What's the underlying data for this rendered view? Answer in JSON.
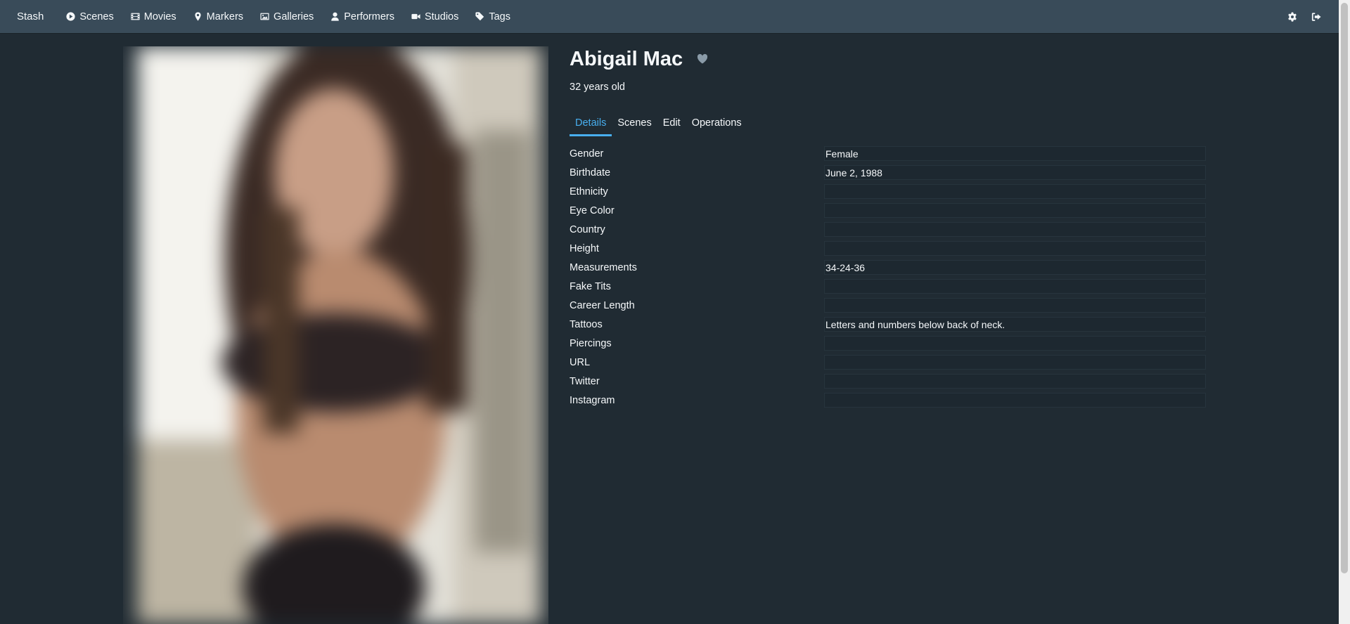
{
  "navbar": {
    "brand": "Stash",
    "items": [
      {
        "label": "Scenes",
        "icon": "play-circle-icon"
      },
      {
        "label": "Movies",
        "icon": "film-icon"
      },
      {
        "label": "Markers",
        "icon": "map-marker-icon"
      },
      {
        "label": "Galleries",
        "icon": "image-icon"
      },
      {
        "label": "Performers",
        "icon": "user-icon"
      },
      {
        "label": "Studios",
        "icon": "video-camera-icon"
      },
      {
        "label": "Tags",
        "icon": "tag-icon"
      }
    ],
    "right_icons": [
      "settings-gear-icon",
      "logout-icon"
    ]
  },
  "performer": {
    "name": "Abigail Mac",
    "age": "32 years old",
    "favorite_icon": "heart-icon"
  },
  "tabs": [
    "Details",
    "Scenes",
    "Edit",
    "Operations"
  ],
  "active_tab": "Details",
  "fields": [
    {
      "label": "Gender",
      "value": "Female"
    },
    {
      "label": "Birthdate",
      "value": "June 2, 1988"
    },
    {
      "label": "Ethnicity",
      "value": ""
    },
    {
      "label": "Eye Color",
      "value": ""
    },
    {
      "label": "Country",
      "value": ""
    },
    {
      "label": "Height",
      "value": ""
    },
    {
      "label": "Measurements",
      "value": "34-24-36"
    },
    {
      "label": "Fake Tits",
      "value": ""
    },
    {
      "label": "Career Length",
      "value": ""
    },
    {
      "label": "Tattoos",
      "value": "Letters and numbers below back of neck."
    },
    {
      "label": "Piercings",
      "value": ""
    },
    {
      "label": "URL",
      "value": ""
    },
    {
      "label": "Twitter",
      "value": ""
    },
    {
      "label": "Instagram",
      "value": ""
    }
  ],
  "colors": {
    "background": "#202b33",
    "navbar": "#394b59",
    "accent": "#48aff0",
    "field_bg": "#1d2830"
  }
}
